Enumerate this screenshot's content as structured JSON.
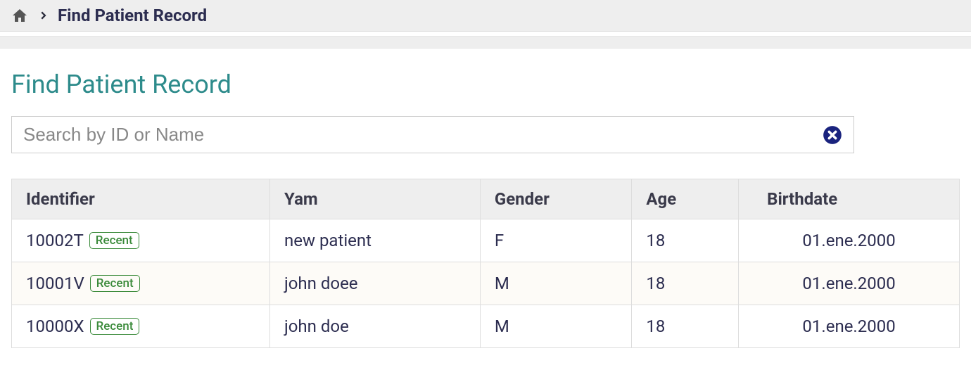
{
  "breadcrumb": {
    "current": "Find Patient Record"
  },
  "page": {
    "title": "Find Patient Record"
  },
  "search": {
    "placeholder": "Search by ID or Name",
    "value": ""
  },
  "table": {
    "headers": {
      "identifier": "Identifier",
      "name": "Yam",
      "gender": "Gender",
      "age": "Age",
      "birthdate": "Birthdate"
    },
    "badge_label": "Recent",
    "rows": [
      {
        "identifier": "10002T",
        "recent": true,
        "name": "new patient",
        "gender": "F",
        "age": "18",
        "birthdate": "01.ene.2000"
      },
      {
        "identifier": "10001V",
        "recent": true,
        "name": "john doee",
        "gender": "M",
        "age": "18",
        "birthdate": "01.ene.2000"
      },
      {
        "identifier": "10000X",
        "recent": true,
        "name": "john doe",
        "gender": "M",
        "age": "18",
        "birthdate": "01.ene.2000"
      }
    ]
  }
}
